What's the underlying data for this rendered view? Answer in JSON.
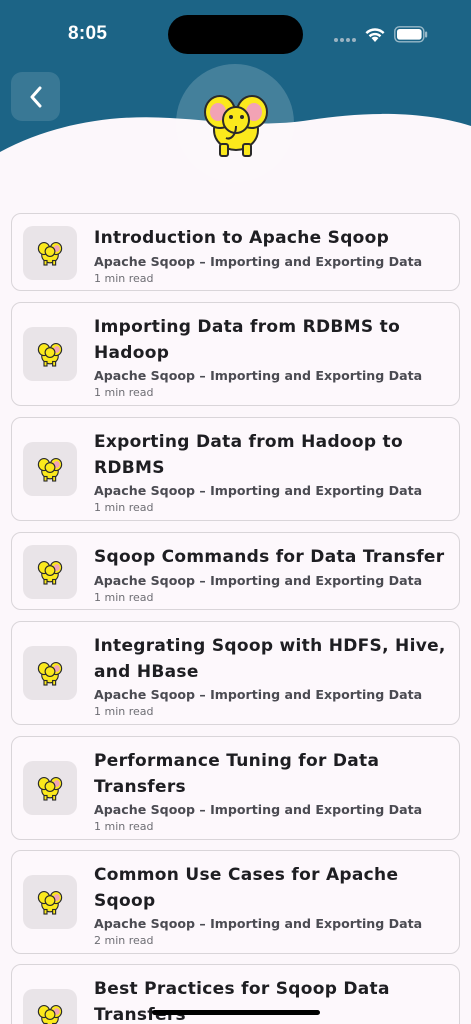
{
  "status_bar": {
    "time": "8:05"
  },
  "header": {
    "back_icon": "chevron-left-icon",
    "mascot_icon": "yellow-elephant-icon",
    "colors": {
      "header_bg": "#1c6486",
      "page_bg": "#fcf7fb"
    }
  },
  "lessons": [
    {
      "title": "Introduction to Apache Sqoop",
      "subtitle": "Apache Sqoop – Importing and Exporting Data",
      "read_time": "1 min read"
    },
    {
      "title": "Importing Data from RDBMS to Hadoop",
      "subtitle": "Apache Sqoop – Importing and Exporting Data",
      "read_time": "1 min read"
    },
    {
      "title": "Exporting Data from Hadoop to RDBMS",
      "subtitle": "Apache Sqoop – Importing and Exporting Data",
      "read_time": "1 min read"
    },
    {
      "title": "Sqoop Commands for Data Transfer",
      "subtitle": "Apache Sqoop – Importing and Exporting Data",
      "read_time": "1 min read"
    },
    {
      "title": "Integrating Sqoop with HDFS, Hive, and HBase",
      "subtitle": "Apache Sqoop – Importing and Exporting Data",
      "read_time": "1 min read"
    },
    {
      "title": "Performance Tuning for Data Transfers",
      "subtitle": "Apache Sqoop – Importing and Exporting Data",
      "read_time": "1 min read"
    },
    {
      "title": "Common Use Cases for Apache Sqoop",
      "subtitle": "Apache Sqoop – Importing and Exporting Data",
      "read_time": "2 min read"
    },
    {
      "title": "Best Practices for Sqoop Data Transfers",
      "subtitle": "",
      "read_time": ""
    }
  ]
}
